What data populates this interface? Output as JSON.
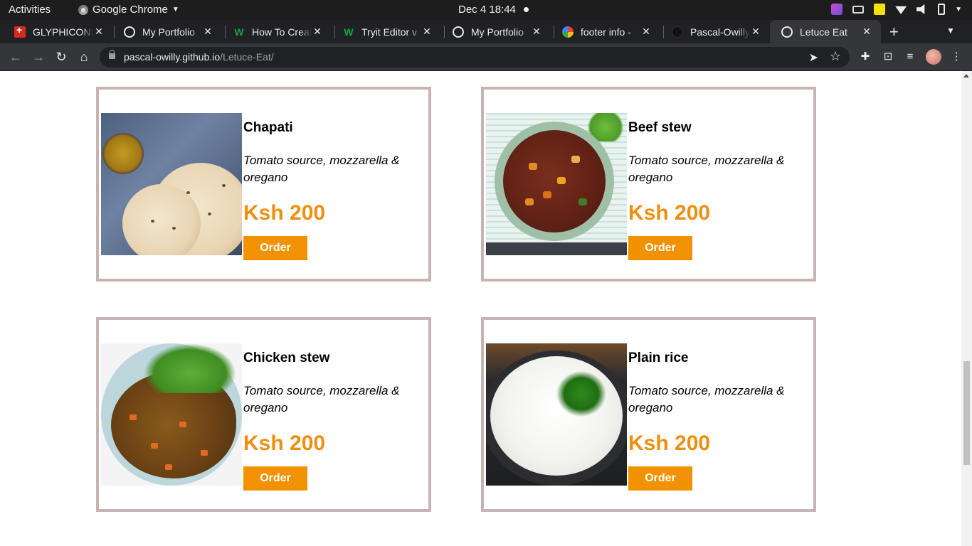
{
  "system": {
    "activities": "Activities",
    "app_name": "Google Chrome",
    "clock": "Dec 4  18:44"
  },
  "tabs": [
    {
      "label": "GLYPHICONS",
      "favicon": "swiss-flag-icon",
      "active": false
    },
    {
      "label": "My Portfolio",
      "favicon": "globe-icon",
      "active": false
    },
    {
      "label": "How To Creat",
      "favicon": "w-logo-icon",
      "active": false
    },
    {
      "label": "Tryit Editor v",
      "favicon": "w-logo-icon",
      "active": false
    },
    {
      "label": "My Portfolio",
      "favicon": "globe-icon",
      "active": false
    },
    {
      "label": "footer info - ",
      "favicon": "google-icon",
      "active": false
    },
    {
      "label": "Pascal-Owilly",
      "favicon": "github-icon",
      "active": false
    },
    {
      "label": "Letuce Eat",
      "favicon": "globe-icon",
      "active": true
    }
  ],
  "address_bar": {
    "host": "pascal-owilly.github.io",
    "path": "/Letuce-Eat/"
  },
  "menu": [
    {
      "name": "Chapati",
      "description": "Tomato source, mozzarella & oregano",
      "price": "Ksh 200",
      "button": "Order",
      "image": "chapati-photo"
    },
    {
      "name": "Beef stew",
      "description": "Tomato source, mozzarella & oregano",
      "price": "Ksh 200",
      "button": "Order",
      "image": "beef-stew-photo"
    },
    {
      "name": "Chicken stew",
      "description": "Tomato source, mozzarella & oregano",
      "price": "Ksh 200",
      "button": "Order",
      "image": "chicken-stew-photo"
    },
    {
      "name": "Plain rice",
      "description": "Tomato source, mozzarella & oregano",
      "price": "Ksh 200",
      "button": "Order",
      "image": "plain-rice-photo"
    }
  ],
  "colors": {
    "accent": "#f39200",
    "price": "#ef8f10",
    "card_border": "#c9b4b4"
  }
}
